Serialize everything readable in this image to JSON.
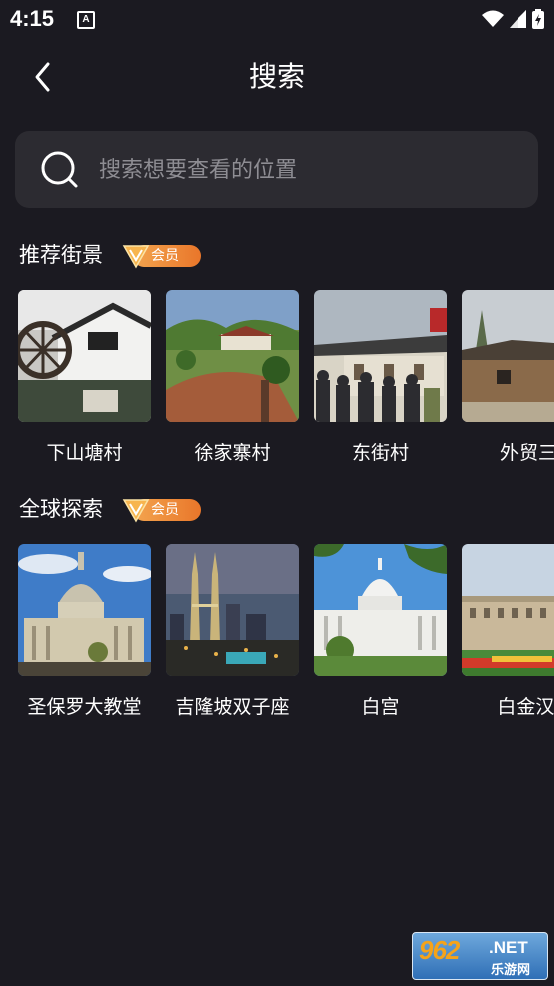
{
  "status_bar": {
    "time": "4:15",
    "notification_glyph": "A"
  },
  "header": {
    "title": "搜索",
    "back_icon": "chevron-left-icon"
  },
  "search": {
    "placeholder": "搜索想要查看的位置",
    "value": ""
  },
  "sections": [
    {
      "title": "推荐街景",
      "badge": "会员",
      "items": [
        {
          "label": "下山塘村",
          "icon": "village-waterwheel-photo"
        },
        {
          "label": "徐家寨村",
          "icon": "village-garden-photo"
        },
        {
          "label": "东街村",
          "icon": "village-crowd-photo"
        },
        {
          "label": "外贸三",
          "icon": "village-house-photo"
        }
      ]
    },
    {
      "title": "全球探索",
      "badge": "会员",
      "items": [
        {
          "label": "圣保罗大教堂",
          "icon": "st-pauls-cathedral-photo"
        },
        {
          "label": "吉隆坡双子座",
          "icon": "petronas-towers-photo"
        },
        {
          "label": "白宫",
          "icon": "white-house-photo"
        },
        {
          "label": "白金汉'",
          "icon": "buckingham-palace-photo"
        }
      ]
    }
  ],
  "watermark": {
    "brand": "962",
    "domain": ".NET",
    "sub": "乐游网"
  },
  "colors": {
    "background": "#1b1a21",
    "search_bg": "#2c2b31",
    "badge_orange": "#ef8a35",
    "placeholder": "#8e8d93"
  }
}
